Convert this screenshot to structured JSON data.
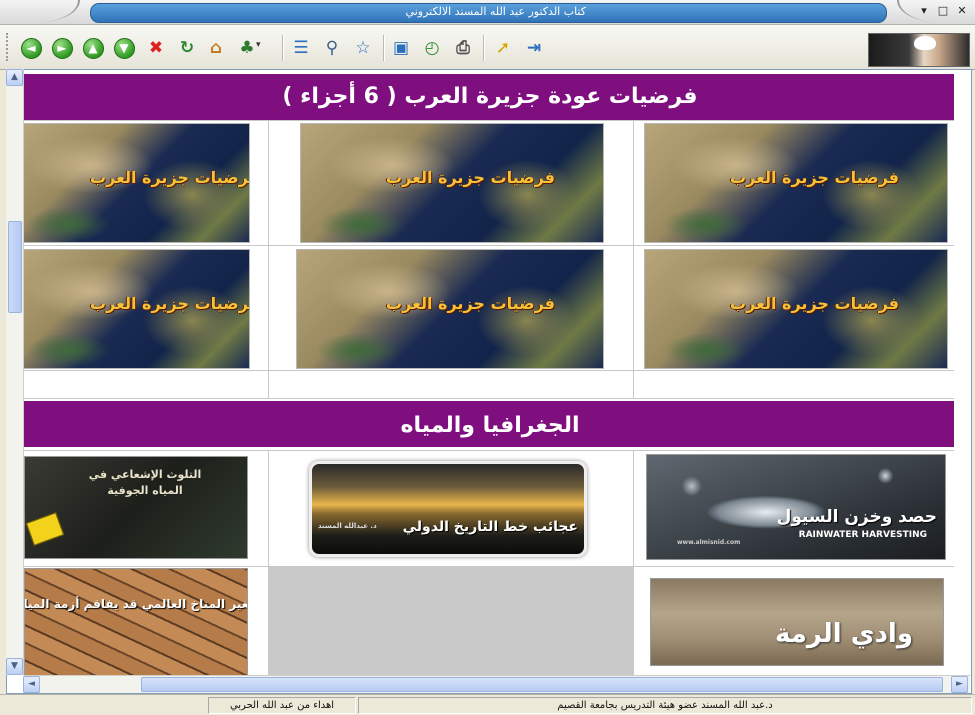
{
  "window": {
    "title": "كتاب الدكتور عبد الله المسند الالكتروني",
    "minimize": "▾",
    "maximize": "□",
    "close": "✕"
  },
  "toolbar": {
    "buttons": [
      {
        "name": "back-button",
        "icon": "arrow-left-icon",
        "glyph": "◄"
      },
      {
        "name": "forward-button",
        "icon": "arrow-right-icon",
        "glyph": "►"
      },
      {
        "name": "up-button",
        "icon": "arrow-up-icon",
        "glyph": "▲"
      },
      {
        "name": "down-button",
        "icon": "arrow-down-icon",
        "glyph": "▼"
      },
      {
        "name": "stop-button",
        "icon": "stop-icon",
        "glyph": "✖"
      },
      {
        "name": "refresh-button",
        "icon": "refresh-icon",
        "glyph": "↻"
      },
      {
        "name": "home-button",
        "icon": "home-icon",
        "glyph": "⌂"
      },
      {
        "name": "tree-button",
        "icon": "tree-icon",
        "glyph": "♣"
      },
      {
        "name": "contents-button",
        "icon": "contents-icon",
        "glyph": "☰"
      },
      {
        "name": "search-button",
        "icon": "search-icon",
        "glyph": "⚲"
      },
      {
        "name": "favorites-button",
        "icon": "star-icon",
        "glyph": "☆"
      },
      {
        "name": "fullscreen-button",
        "icon": "window-icon",
        "glyph": "▣"
      },
      {
        "name": "history-button",
        "icon": "history-icon",
        "glyph": "◴"
      },
      {
        "name": "print-button",
        "icon": "printer-icon",
        "glyph": "⎙"
      },
      {
        "name": "pointer-button",
        "icon": "cursor-icon",
        "glyph": "➚"
      },
      {
        "name": "exit-button",
        "icon": "exit-icon",
        "glyph": "⇥"
      }
    ]
  },
  "sections": [
    {
      "title": "فرضيات عودة جزيرة العرب ( 6 أجزاء )",
      "map_caption": "فرضيات جزيرة العرب"
    },
    {
      "title": "الجغرافيا والمياه",
      "items": [
        {
          "title": "حصد وخزن السيول",
          "subtitle": "RAINWATER HARVESTING",
          "site": "www.almisnid.com"
        },
        {
          "title": "عجائب خط التاريخ الدولي",
          "author": "د. عبدالله المسند"
        },
        {
          "title": "التلوث الإشعاعي في المياه الجوفية"
        },
        {
          "title": "وادي الرمة"
        },
        {
          "title": "تغير المناخ العالمي قد يفاقم أزمة المياه"
        }
      ]
    }
  ],
  "colors": {
    "banner": "#7f0f7f",
    "map_label": "#f6c23a"
  },
  "status": {
    "left": "اهداء من عبد الله الحربي",
    "right": "د.عبد الله المسند عضو هيئة التدريس بجامعة القصيم"
  }
}
